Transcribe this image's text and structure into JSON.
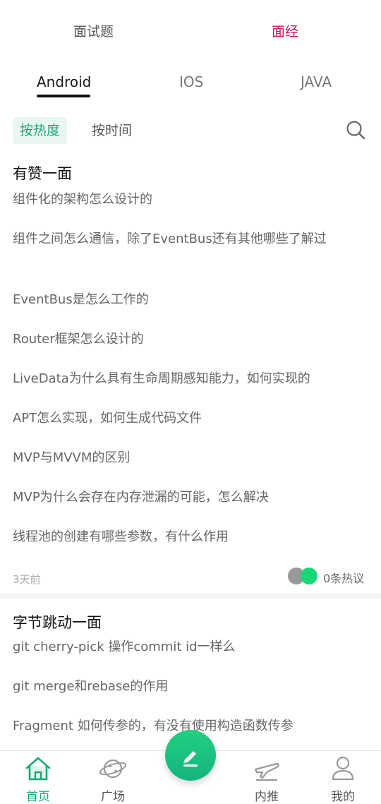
{
  "top_tabs": {
    "interview_questions": "面试题",
    "interview_experience": "面经"
  },
  "sub_tabs": {
    "android": "Android",
    "ios": "IOS",
    "java": "JAVA"
  },
  "sort": {
    "by_hot": "按热度",
    "by_time": "按时间"
  },
  "colors": {
    "accent": "#1aa67a",
    "pink": "#c2185b",
    "toggle_on": "#16d973"
  },
  "posts": [
    {
      "title": "有赞一面",
      "questions": [
        "组件化的架构怎么设计的",
        "组件之间怎么通信，除了EventBus还有其他哪些了解过",
        "EventBus是怎么工作的",
        "Router框架怎么设计的",
        "LiveData为什么具有生命周期感知能力，如何实现的",
        "APT怎么实现，如何生成代码文件",
        "MVP与MVVM的区别",
        "MVP为什么会存在内存泄漏的可能，怎么解决",
        "线程池的创建有哪些参数，有什么作用"
      ],
      "time": "3天前",
      "comments": "0条热议"
    },
    {
      "title": "字节跳动一面",
      "questions": [
        "git  cherry-pick 操作commit id一样么",
        "git merge和rebase的作用",
        "Fragment  如何传参的，有没有使用构造函数传参"
      ]
    }
  ],
  "bottom_nav": {
    "home": "首页",
    "square": "广场",
    "referral": "内推",
    "mine": "我的"
  },
  "icons": {
    "search": "search-icon",
    "home": "home-icon",
    "planet": "planet-icon",
    "plane": "plane-icon",
    "user": "user-icon",
    "edit": "pencil-icon"
  }
}
